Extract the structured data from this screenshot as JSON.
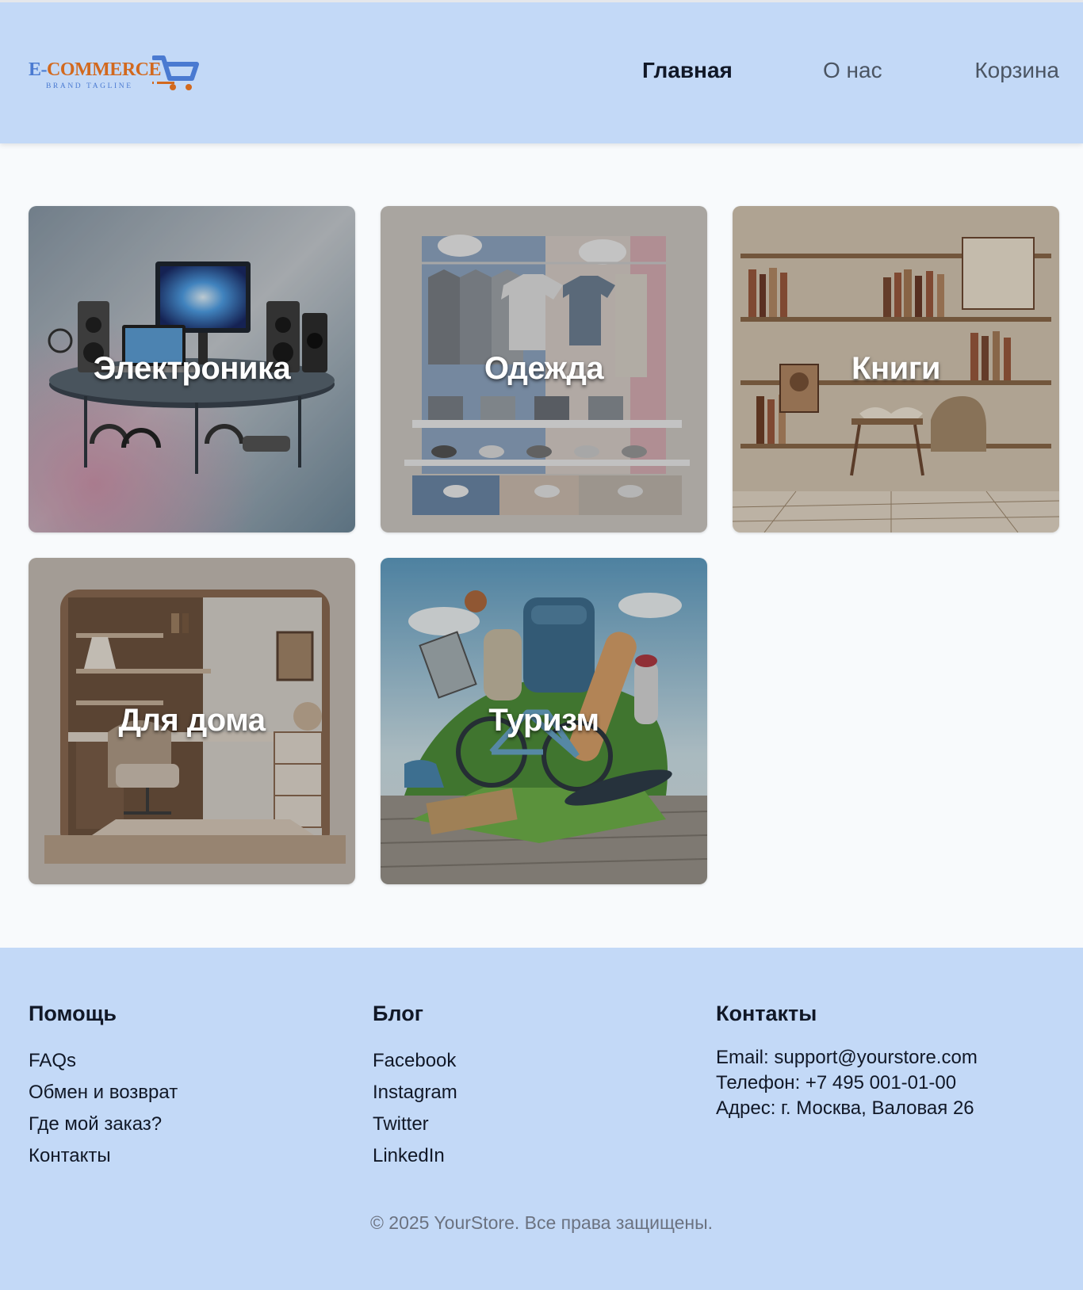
{
  "header": {
    "logo": {
      "brand_prefix": "E-",
      "brand_name": "COMMERCE",
      "tagline": "BRAND TAGLINE"
    },
    "nav": [
      {
        "label": "Главная",
        "active": true
      },
      {
        "label": "О нас",
        "active": false
      },
      {
        "label": "Корзина",
        "active": false
      }
    ]
  },
  "categories": [
    {
      "label": "Электроника"
    },
    {
      "label": "Одежда"
    },
    {
      "label": "Книги"
    },
    {
      "label": "Для дома"
    },
    {
      "label": "Туризм"
    }
  ],
  "footer": {
    "help": {
      "title": "Помощь",
      "links": [
        "FAQs",
        "Обмен и возврат",
        "Где мой заказ?",
        "Контакты"
      ]
    },
    "blog": {
      "title": "Блог",
      "links": [
        "Facebook",
        "Instagram",
        "Twitter",
        "LinkedIn"
      ]
    },
    "contacts": {
      "title": "Контакты",
      "email": "Email: support@yourstore.com",
      "phone": "Телефон: +7 495 001-01-00",
      "address": "Адрес: г. Москва, Валовая 26"
    },
    "copyright": "© 2025 YourStore. Все права защищены."
  },
  "colors": {
    "header_bg": "#c3d9f7",
    "footer_bg": "#c3d9f7",
    "page_bg": "#f8fafc",
    "logo_blue": "#4a7ad1",
    "logo_orange": "#d2691e"
  }
}
